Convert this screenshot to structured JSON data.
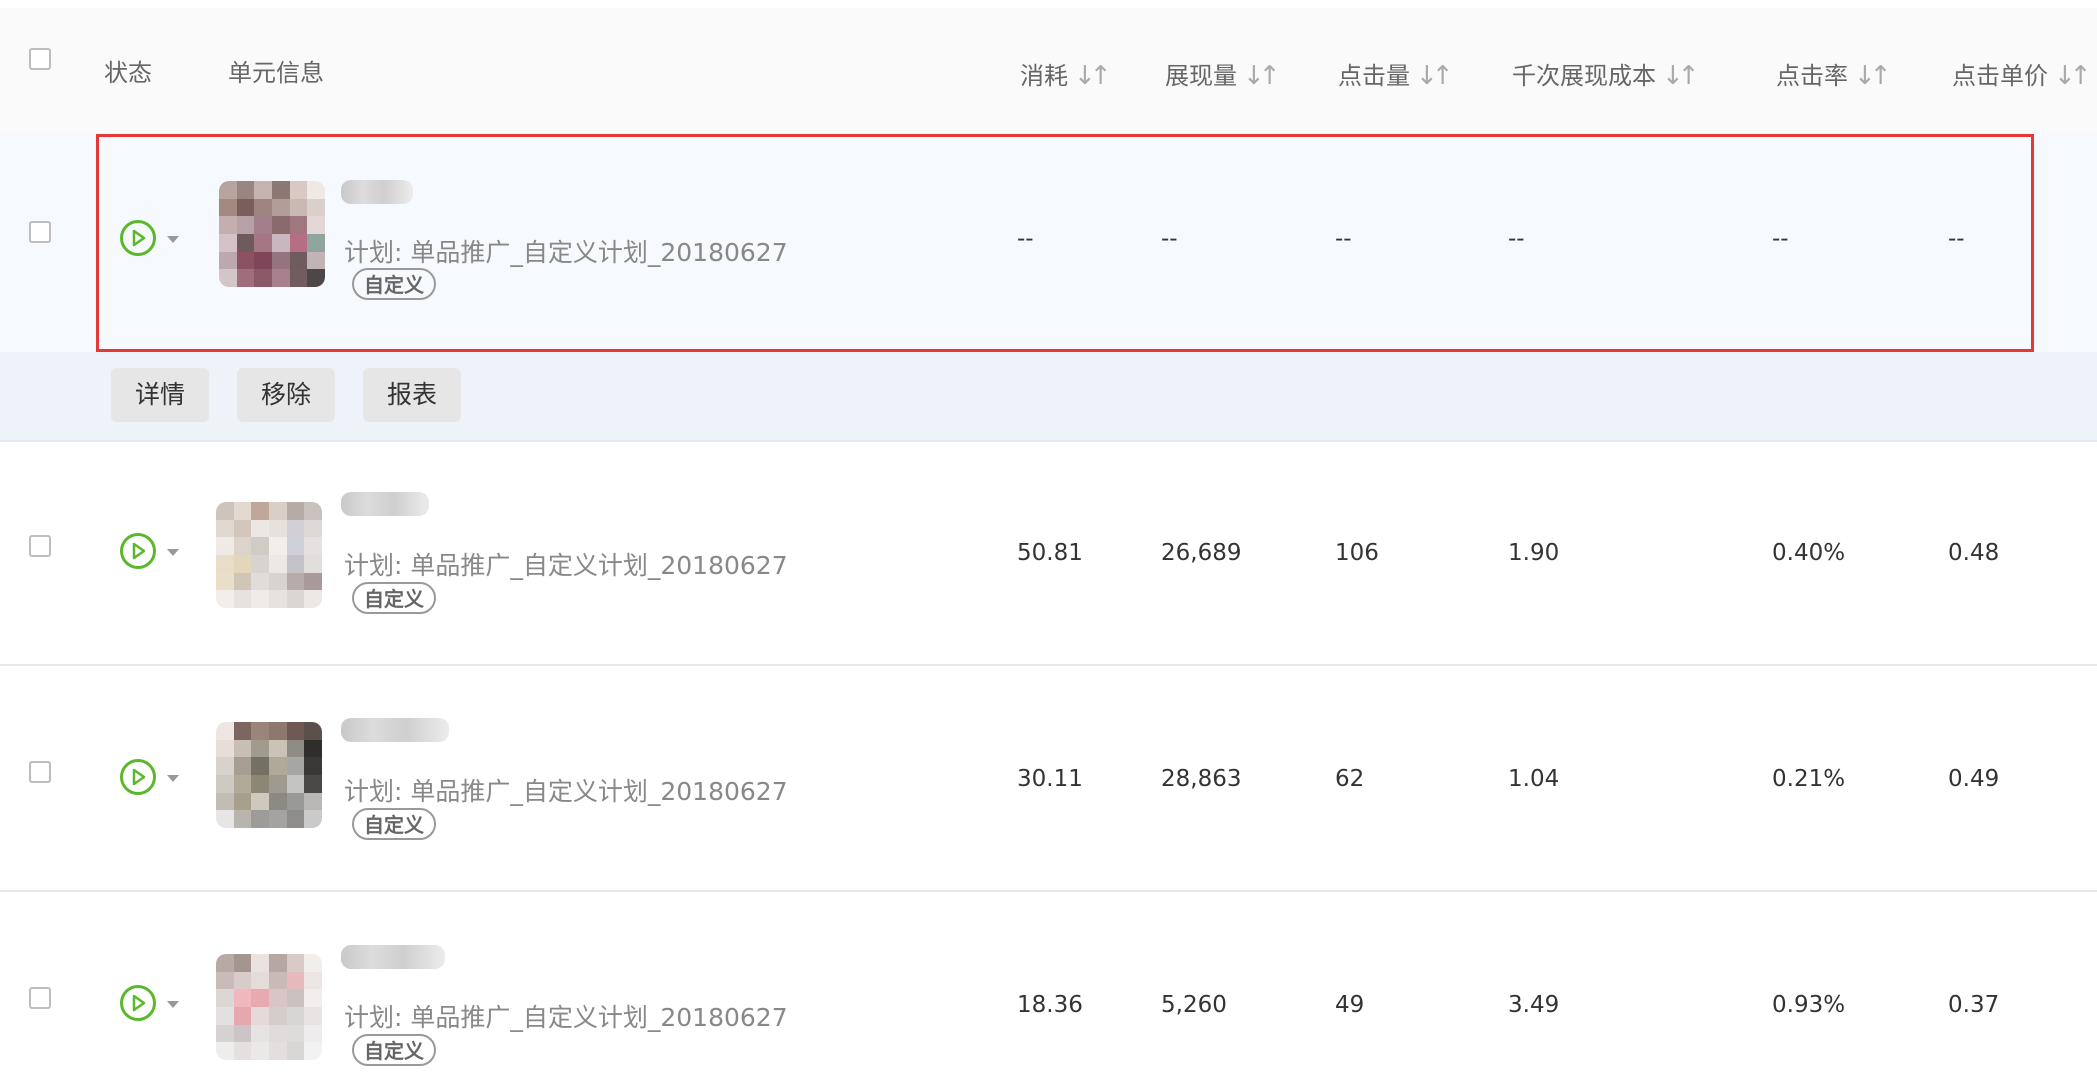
{
  "header": {
    "status": "状态",
    "unit_info": "单元信息",
    "cols": [
      "消耗",
      "展现量",
      "点击量",
      "千次展现成本",
      "点击率",
      "点击单价"
    ],
    "sort_glyph": "↓↑"
  },
  "rows": [
    {
      "plan": "计划:  单品推广_自定义计划_20180627",
      "tag": "自定义",
      "values": [
        "--",
        "--",
        "--",
        "--",
        "--",
        "--"
      ]
    },
    {
      "plan": "计划:  单品推广_自定义计划_20180627",
      "tag": "自定义",
      "values": [
        "50.81",
        "26,689",
        "106",
        "1.90",
        "0.40%",
        "0.48"
      ]
    },
    {
      "plan": "计划:  单品推广_自定义计划_20180627",
      "tag": "自定义",
      "values": [
        "30.11",
        "28,863",
        "62",
        "1.04",
        "0.21%",
        "0.49"
      ]
    },
    {
      "plan": "计划:  单品推广_自定义计划_20180627",
      "tag": "自定义",
      "values": [
        "18.36",
        "5,260",
        "49",
        "3.49",
        "0.93%",
        "0.37"
      ]
    }
  ],
  "actions": [
    "详情",
    "移除",
    "报表"
  ],
  "colors": {
    "accent": "#5cb82b",
    "highlight": "#e53935"
  },
  "icons": [
    "checkbox-icon",
    "play-circle-icon",
    "chevron-down-icon",
    "sort-icon"
  ]
}
